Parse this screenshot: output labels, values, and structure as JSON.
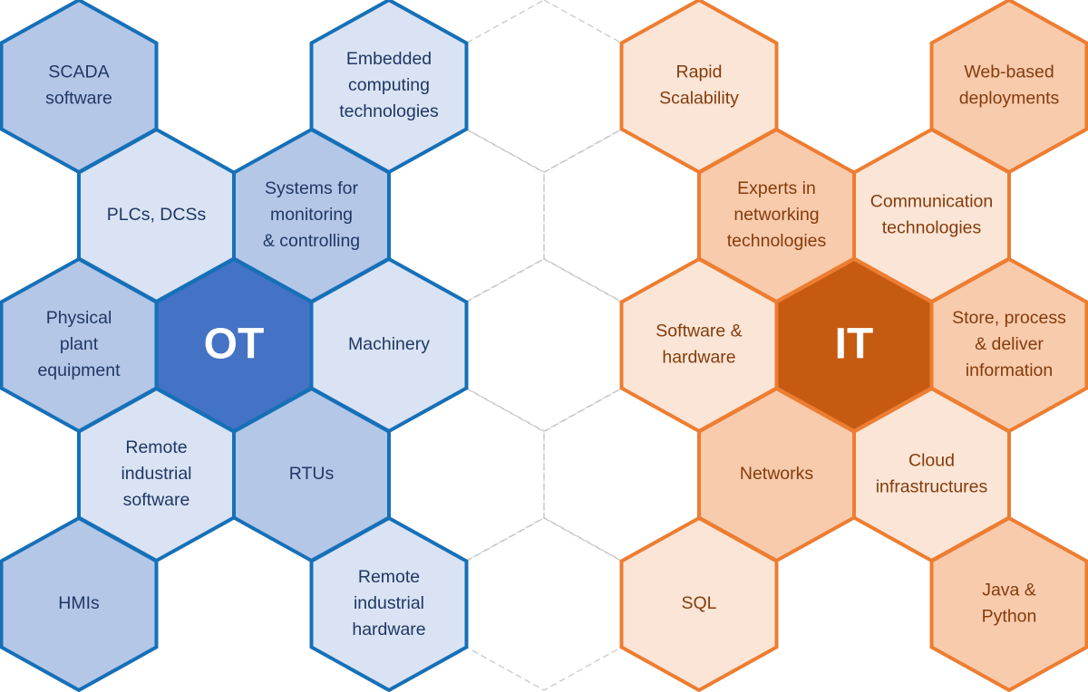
{
  "colors": {
    "ot": {
      "border": "#1670b8",
      "dark": "#4472c4",
      "medium": "#b4c7e7",
      "light": "#dae3f3",
      "text": "#203864"
    },
    "it": {
      "border": "#ed7d31",
      "dark": "#c55a11",
      "medium": "#f8cbad",
      "light": "#fbe5d6",
      "text": "#843c0c"
    },
    "connector": "#c8c8c8"
  },
  "ot": {
    "center": {
      "label": "OT"
    },
    "cells": [
      {
        "id": "scada",
        "lines": [
          "SCADA",
          "software"
        ],
        "fill": "medium"
      },
      {
        "id": "embedded",
        "lines": [
          "Embedded",
          "computing",
          "technologies"
        ],
        "fill": "light"
      },
      {
        "id": "plcs",
        "lines": [
          "PLCs, DCSs"
        ],
        "fill": "light"
      },
      {
        "id": "systems",
        "lines": [
          "Systems for",
          "monitoring",
          "& controlling"
        ],
        "fill": "medium"
      },
      {
        "id": "physical",
        "lines": [
          "Physical",
          "plant",
          "equipment"
        ],
        "fill": "medium"
      },
      {
        "id": "machinery",
        "lines": [
          "Machinery"
        ],
        "fill": "light"
      },
      {
        "id": "remote-software",
        "lines": [
          "Remote",
          "industrial",
          "software"
        ],
        "fill": "light"
      },
      {
        "id": "rtus",
        "lines": [
          "RTUs"
        ],
        "fill": "medium"
      },
      {
        "id": "hmis",
        "lines": [
          "HMIs"
        ],
        "fill": "medium"
      },
      {
        "id": "remote-hardware",
        "lines": [
          "Remote",
          "industrial",
          "hardware"
        ],
        "fill": "light"
      }
    ]
  },
  "it": {
    "center": {
      "label": "IT"
    },
    "cells": [
      {
        "id": "rapid",
        "lines": [
          "Rapid",
          "Scalability"
        ],
        "fill": "light"
      },
      {
        "id": "web",
        "lines": [
          "Web-based",
          "deployments"
        ],
        "fill": "medium"
      },
      {
        "id": "experts",
        "lines": [
          "Experts in",
          "networking",
          "technologies"
        ],
        "fill": "medium"
      },
      {
        "id": "communication",
        "lines": [
          "Communication",
          "technologies"
        ],
        "fill": "light"
      },
      {
        "id": "software-hardware",
        "lines": [
          "Software &",
          "hardware"
        ],
        "fill": "light"
      },
      {
        "id": "store",
        "lines": [
          "Store, process",
          "& deliver",
          "information"
        ],
        "fill": "medium"
      },
      {
        "id": "networks",
        "lines": [
          "Networks"
        ],
        "fill": "medium"
      },
      {
        "id": "cloud",
        "lines": [
          "Cloud",
          "infrastructures"
        ],
        "fill": "light"
      },
      {
        "id": "sql",
        "lines": [
          "SQL"
        ],
        "fill": "light"
      },
      {
        "id": "java",
        "lines": [
          "Java &",
          "Python"
        ],
        "fill": "medium"
      }
    ]
  }
}
